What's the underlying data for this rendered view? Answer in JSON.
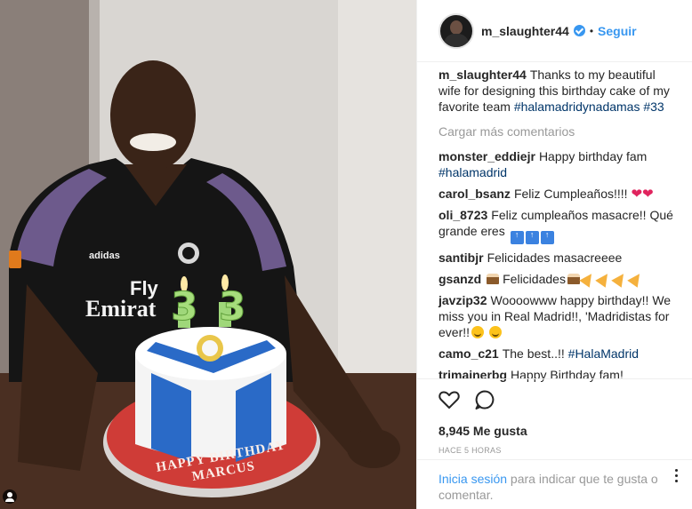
{
  "header": {
    "username": "m_slaughter44",
    "separator": "•",
    "follow_label": "Seguir"
  },
  "caption": {
    "username": "m_slaughter44",
    "text": "Thanks to my beautiful wife for designing this birthday cake of my favorite team ",
    "tags": "#halamadridynadamas #33"
  },
  "load_more_label": "Cargar más comentarios",
  "comments": [
    {
      "user": "monster_eddiejr",
      "text": "Happy birthday fam",
      "tag": "#halamadrid"
    },
    {
      "user": "carol_bsanz",
      "text": "Feliz Cumpleaños!!!!"
    },
    {
      "user": "oli_8723",
      "text": "Feliz cumpleaños masacre!! Qué grande eres"
    },
    {
      "user": "santibjr",
      "text": "Felicidades masacreeee"
    },
    {
      "user": "gsanzd",
      "text": "Felicidades"
    },
    {
      "user": "javzip32",
      "text": "Woooowww happy birthday!! We miss you in Real Madrid!!, 'Madridistas for ever!!"
    },
    {
      "user": "camo_c21",
      "text": "The best..!! ",
      "tag": "#HalaMadrid"
    },
    {
      "user": "trimainerbg",
      "text": "Happy Birthday fam!"
    }
  ],
  "likes": "8,945 Me gusta",
  "time_ago": "HACE 5 HORAS",
  "login": {
    "link": "Inicia sesión",
    "text": " para indicar que te gusta o comentar."
  },
  "photo": {
    "jersey_sponsor_line1": "Fly",
    "jersey_sponsor_line2": "Emirat",
    "jersey_brand": "adidas",
    "candles": "3 3",
    "cake_text": "HAPPY BIRTHDAY MARCUS"
  },
  "colors": {
    "link_blue": "#3897f0",
    "hashtag": "#003569",
    "muted": "#999999",
    "heart": "#e0245e"
  }
}
